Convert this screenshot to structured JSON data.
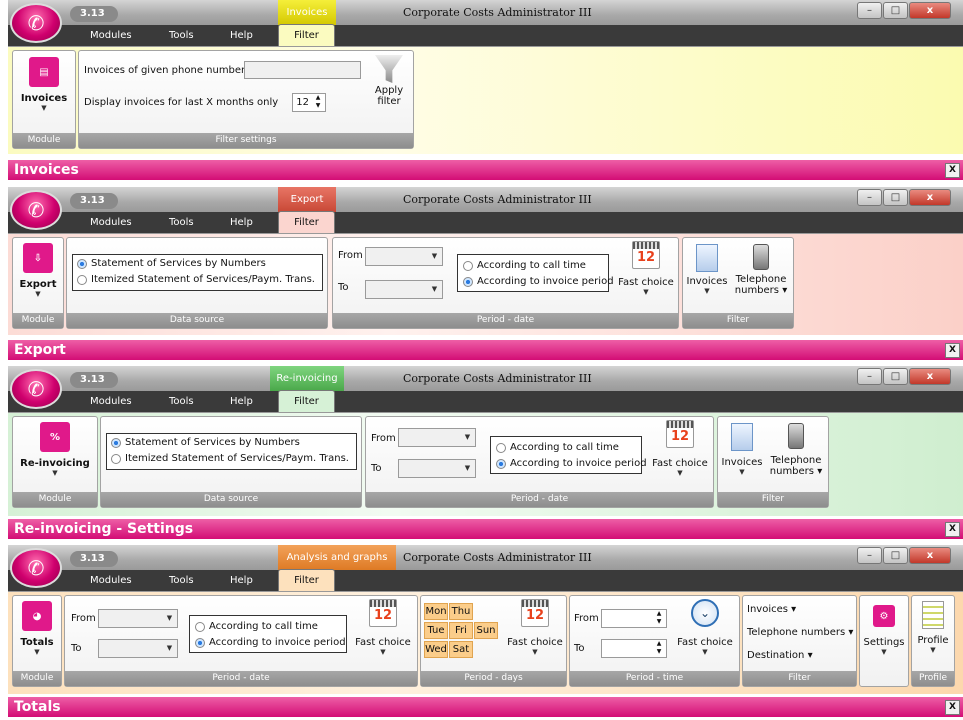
{
  "app": {
    "version": "3.13",
    "title": "Corporate Costs Administrator III",
    "menu": [
      "Modules",
      "Tools",
      "Help"
    ],
    "filter_tab": "Filter",
    "module_label": "Module",
    "close_label": "X",
    "window_buttons": {
      "minimize": "–",
      "maximize": "□",
      "close": "x"
    }
  },
  "panels": [
    {
      "context_tab": "Invoices",
      "module_button": "Invoices",
      "phone_label": "Invoices of given phone number",
      "phone_value": "",
      "months_label": "Display invoices for last X months only",
      "months_value": "12",
      "apply_label_1": "Apply",
      "apply_label_2": "filter",
      "group_label": "Filter settings",
      "header": "Invoices",
      "colors": {
        "tab": "#e6e000",
        "ribbon": "#fbfbc0"
      }
    },
    {
      "context_tab": "Export",
      "module_button": "Export",
      "ds_option_1": "Statement of Services by Numbers",
      "ds_option_2": "Itemized Statement of Services/Paym. Trans.",
      "ds_group": "Data source",
      "from_label": "From",
      "to_label": "To",
      "call_time": "According to call time",
      "invoice_period": "According to invoice period",
      "fast_choice": "Fast choice",
      "period_group": "Period - date",
      "invoices": "Invoices",
      "tel_1": "Telephone",
      "tel_2": "numbers",
      "filter_group": "Filter",
      "header": "Export",
      "colors": {
        "tab": "#d75a4a",
        "ribbon": "#fbd5cf"
      }
    },
    {
      "context_tab": "Re-invoicing",
      "module_button": "Re-invoicing",
      "module_icon": "%",
      "ds_option_1": "Statement of Services by Numbers",
      "ds_option_2": "Itemized Statement of Services/Paym. Trans.",
      "ds_group": "Data source",
      "from_label": "From",
      "to_label": "To",
      "call_time": "According to call time",
      "invoice_period": "According to invoice period",
      "fast_choice": "Fast choice",
      "period_group": "Period - date",
      "invoices": "Invoices",
      "tel_1": "Telephone",
      "tel_2": "numbers",
      "filter_group": "Filter",
      "header": "Re-invoicing - Settings",
      "colors": {
        "tab": "#5cbd5c",
        "ribbon": "#d6f1d6"
      }
    },
    {
      "context_tab": "Analysis and graphs",
      "module_button": "Totals",
      "from_label": "From",
      "to_label": "To",
      "call_time": "According to call time",
      "invoice_period": "According to invoice period",
      "fast_choice": "Fast choice",
      "period_date_group": "Period - date",
      "days": [
        "Mon",
        "Thu",
        "Tue",
        "Fri",
        "Sun",
        "Wed",
        "Sat"
      ],
      "period_days_group": "Period - days",
      "period_time_group": "Period - time",
      "filter_invoices": "Invoices",
      "filter_tel": "Telephone numbers",
      "filter_dest": "Destination",
      "filter_group": "Filter",
      "settings": "Settings",
      "profile": "Profile",
      "profile_group": "Profile",
      "header": "Totals",
      "colors": {
        "tab": "#ee8a3a",
        "ribbon": "#fde1bd"
      }
    }
  ],
  "calendar_number": "12"
}
